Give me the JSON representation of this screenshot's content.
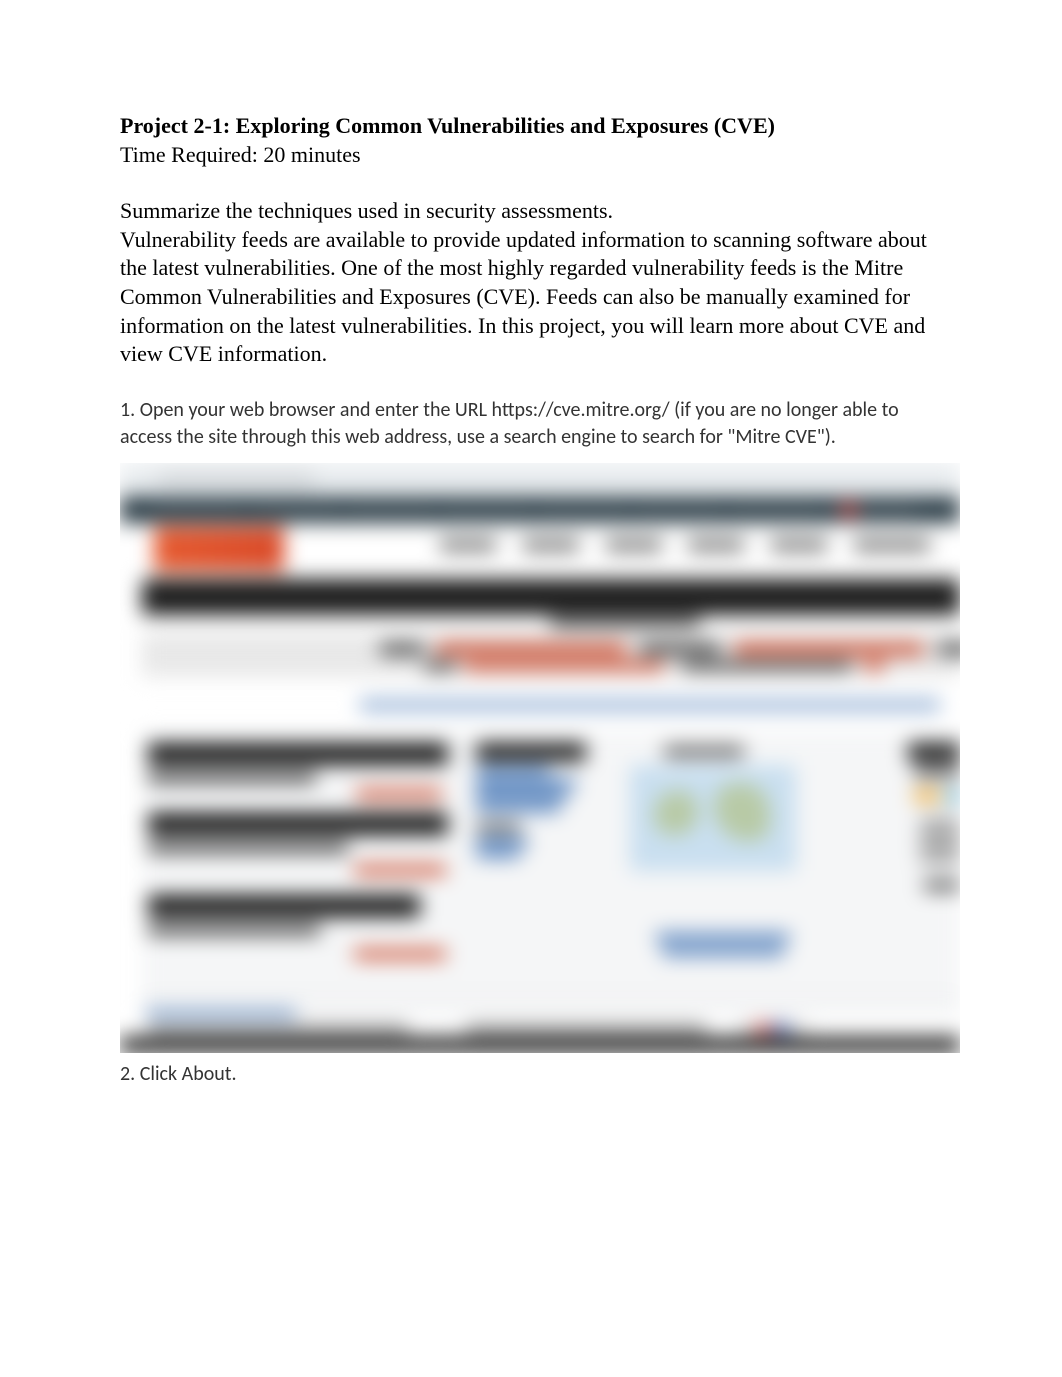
{
  "document": {
    "title": "Project 2-1: Exploring Common Vulnerabilities and Exposures (CVE)",
    "time_required_label": "Time Required:  20 minutes",
    "summary_line": "Summarize the techniques used in security assessments.",
    "body_paragraph": "Vulnerability feeds are available to provide updated information to scanning software about the latest vulnerabilities. One of the most highly regarded vulnerability feeds is the Mitre Common Vulnerabilities and Exposures (CVE). Feeds can also be manually examined for information on the latest vulnerabilities. In this project, you will learn more about CVE and view CVE information.",
    "step1": "1.  Open your web browser and enter the URL https://cve.mitre.org/ (if you are no longer able to access the site through this web address, use a search engine to search for \"Mitre CVE\").",
    "step2": "2.  Click About.",
    "screenshot_alt": "Blurred screenshot of the CVE (Common Vulnerabilities and Exposures) website at cve.mitre.org"
  }
}
